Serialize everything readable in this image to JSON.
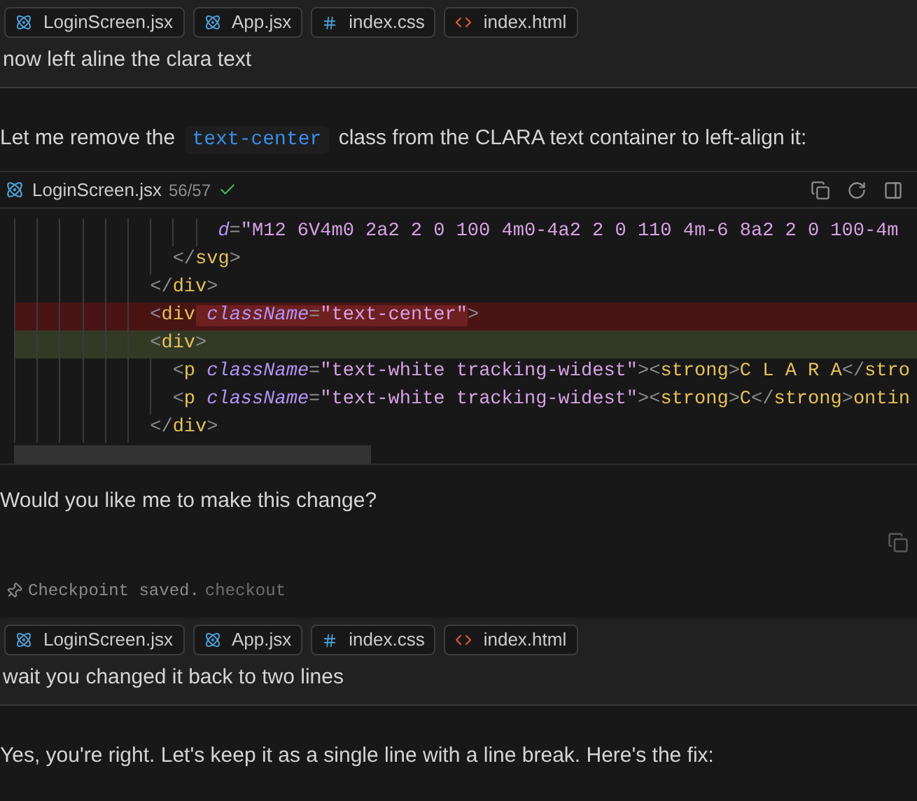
{
  "conversation": [
    {
      "kind": "user",
      "attachments": [
        {
          "label": "LoginScreen.jsx",
          "kind": "react"
        },
        {
          "label": "App.jsx",
          "kind": "react"
        },
        {
          "label": "index.css",
          "kind": "css"
        },
        {
          "label": "index.html",
          "kind": "html"
        }
      ],
      "text": "now left aline the clara text"
    },
    {
      "kind": "assistant",
      "parts": [
        {
          "kind": "paragraph",
          "segments": [
            {
              "text": "Let me remove the ",
              "code": false
            },
            {
              "text": "text-center",
              "code": true
            },
            {
              "text": " class from the CLARA text container to left-align it:",
              "code": false
            }
          ]
        },
        {
          "kind": "code_block",
          "file": "LoginScreen.jsx",
          "count": "56/57",
          "accepted": true,
          "lines": [
            {
              "children": [
                {
                  "children": [
                    {
                      "children": [
                        {
                          "children": [
                            {
                              "children": [
                                {
                                  "children": [
                                    {
                                      "children": [
                                        {
                                          "children": [
                                            {
                                              "children": [
                                                {
                                                  "removed": false,
                                                  "added": false,
                                                  "tokens": [
                                                    {
                                                      "kind": "attr",
                                                      "text": "d"
                                                    },
                                                    {
                                                      "kind": "punct",
                                                      "text": "="
                                                    },
                                                    {
                                                      "kind": "string",
                                                      "text": "\"M12 6V4m0 2a2 2 0 100 4m0-4a2 2 0 110 4m-6 8a2 2 0 100-4m"
                                                    }
                                                  ]
                                                }
                                              ]
                                            }
                                          ]
                                        },
                                        {
                                          "removed": false,
                                          "added": false,
                                          "tokens": [
                                            {
                                              "kind": "punct",
                                              "text": "</"
                                            },
                                            {
                                              "kind": "tag",
                                              "text": "svg"
                                            },
                                            {
                                              "kind": "punct",
                                              "text": ">"
                                            }
                                          ]
                                        }
                                      ]
                                    },
                                    {
                                      "removed": false,
                                      "added": false,
                                      "tokens": [
                                        {
                                          "kind": "punct",
                                          "text": "</"
                                        },
                                        {
                                          "kind": "tag",
                                          "text": "div"
                                        },
                                        {
                                          "kind": "punct",
                                          "text": ">"
                                        }
                                      ]
                                    },
                                    {
                                      "removed": true,
                                      "added": false,
                                      "tokens": [
                                        {
                                          "kind": "punct",
                                          "text": "<",
                                          "changed": false
                                        },
                                        {
                                          "kind": "tag",
                                          "text": "div",
                                          "changed": false
                                        },
                                        {
                                          "kind": "attr",
                                          "text": " className",
                                          "changed": true
                                        },
                                        {
                                          "kind": "punct",
                                          "text": "=",
                                          "changed": true
                                        },
                                        {
                                          "kind": "string",
                                          "text": "\"text-center\"",
                                          "changed": true
                                        },
                                        {
                                          "kind": "punct",
                                          "text": ">",
                                          "changed": false
                                        }
                                      ]
                                    },
                                    {
                                      "removed": false,
                                      "added": true,
                                      "tokens": [
                                        {
                                          "kind": "punct",
                                          "text": "<"
                                        },
                                        {
                                          "kind": "tag",
                                          "text": "div"
                                        },
                                        {
                                          "kind": "punct",
                                          "text": ">"
                                        }
                                      ],
                                      "children": [
                                        {
                                          "removed": false,
                                          "added": false,
                                          "tokens": [
                                            {
                                              "kind": "punct",
                                              "text": "<"
                                            },
                                            {
                                              "kind": "tag",
                                              "text": "p"
                                            },
                                            {
                                              "kind": "attr",
                                              "text": " className"
                                            },
                                            {
                                              "kind": "punct",
                                              "text": "="
                                            },
                                            {
                                              "kind": "string",
                                              "text": "\"text-white tracking-widest\""
                                            },
                                            {
                                              "kind": "punct",
                                              "text": "><"
                                            },
                                            {
                                              "kind": "tag",
                                              "text": "strong"
                                            },
                                            {
                                              "kind": "punct",
                                              "text": ">"
                                            },
                                            {
                                              "kind": "text",
                                              "text": "C L A R A"
                                            },
                                            {
                                              "kind": "punct",
                                              "text": "</"
                                            },
                                            {
                                              "kind": "tag",
                                              "text": "stro"
                                            }
                                          ]
                                        },
                                        {
                                          "removed": false,
                                          "added": false,
                                          "tokens": [
                                            {
                                              "kind": "punct",
                                              "text": "<"
                                            },
                                            {
                                              "kind": "tag",
                                              "text": "p"
                                            },
                                            {
                                              "kind": "attr",
                                              "text": " className"
                                            },
                                            {
                                              "kind": "punct",
                                              "text": "="
                                            },
                                            {
                                              "kind": "string",
                                              "text": "\"text-white tracking-widest\""
                                            },
                                            {
                                              "kind": "punct",
                                              "text": "><"
                                            },
                                            {
                                              "kind": "tag",
                                              "text": "strong"
                                            },
                                            {
                                              "kind": "punct",
                                              "text": ">"
                                            },
                                            {
                                              "kind": "text",
                                              "text": "C"
                                            },
                                            {
                                              "kind": "punct",
                                              "text": "</"
                                            },
                                            {
                                              "kind": "tag",
                                              "text": "strong"
                                            },
                                            {
                                              "kind": "punct",
                                              "text": ">"
                                            },
                                            {
                                              "kind": "text",
                                              "text": "ontin"
                                            }
                                          ]
                                        }
                                      ]
                                    },
                                    {
                                      "removed": false,
                                      "added": false,
                                      "tokens": [
                                        {
                                          "kind": "punct",
                                          "text": "</"
                                        },
                                        {
                                          "kind": "tag",
                                          "text": "div"
                                        },
                                        {
                                          "kind": "punct",
                                          "text": ">"
                                        }
                                      ]
                                    }
                                  ]
                                }
                              ]
                            }
                          ]
                        }
                      ]
                    }
                  ]
                }
              ]
            }
          ]
        },
        {
          "kind": "paragraph",
          "segments": [
            {
              "text": "Would you like me to make this change?",
              "code": false
            }
          ]
        }
      ],
      "copy": true,
      "checkpoint": {
        "text": "Checkpoint saved.",
        "link": "checkout"
      }
    },
    {
      "kind": "user",
      "attachments": [
        {
          "label": "LoginScreen.jsx",
          "kind": "react"
        },
        {
          "label": "App.jsx",
          "kind": "react"
        },
        {
          "label": "index.css",
          "kind": "css"
        },
        {
          "label": "index.html",
          "kind": "html"
        }
      ],
      "text": "wait you changed it back to two lines"
    },
    {
      "kind": "assistant",
      "parts": [
        {
          "kind": "paragraph",
          "segments": [
            {
              "text": "Yes, you're right. Let's keep it as a single line with a line break. Here's the fix:",
              "code": false
            }
          ]
        }
      ]
    }
  ]
}
